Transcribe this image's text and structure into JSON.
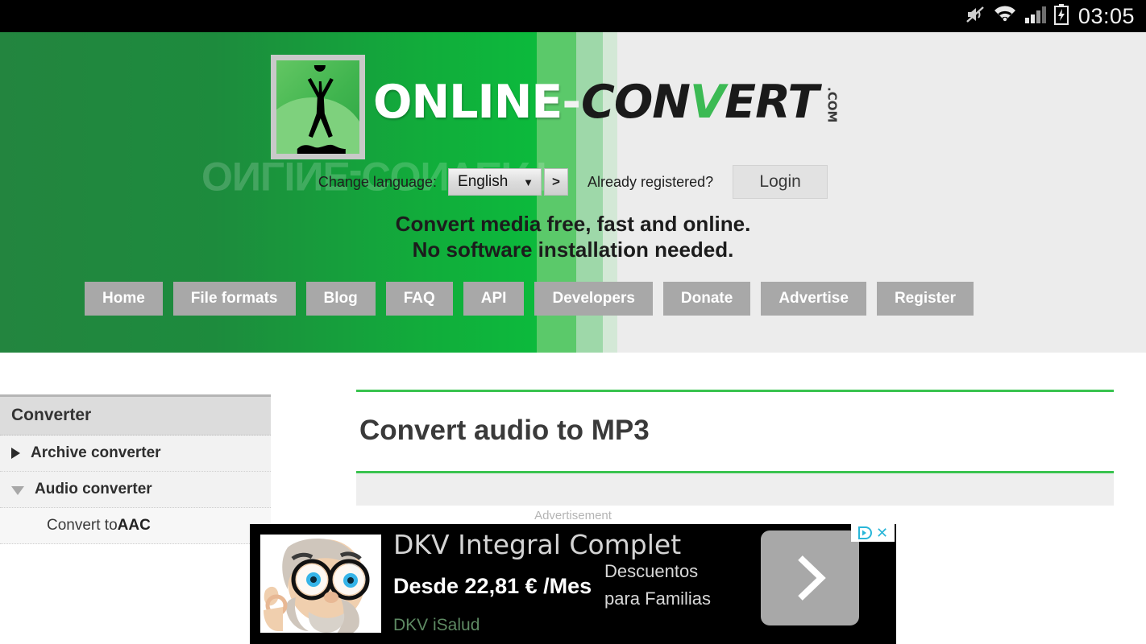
{
  "statusbar": {
    "time": "03:05",
    "icons": [
      "mute-icon",
      "wifi-icon",
      "signal-icon",
      "battery-charging-icon"
    ]
  },
  "header": {
    "logo": {
      "online": "ONLINE",
      "dash": "-",
      "convert_pre": "CON",
      "convert_v": "V",
      "convert_post": "ERT",
      "com": ".COM",
      "reflection": "ONLINE-CONVERT"
    },
    "language": {
      "label": "Change language:",
      "selected": "English",
      "caret": "▼",
      "go_label": ">"
    },
    "account": {
      "already_registered": "Already registered?",
      "login_label": "Login"
    },
    "tagline_line1": "Convert media free, fast and online.",
    "tagline_line2": "No software installation needed.",
    "nav": [
      {
        "label": "Home"
      },
      {
        "label": "File formats"
      },
      {
        "label": "Blog"
      },
      {
        "label": "FAQ"
      },
      {
        "label": "API"
      },
      {
        "label": "Developers"
      },
      {
        "label": "Donate"
      },
      {
        "label": "Advertise"
      },
      {
        "label": "Register"
      }
    ],
    "colors": {
      "green_dark": "#23853f",
      "green_bright": "#0cba3c",
      "green_light": "#5bc96a",
      "green_pale": "#9ed8a9",
      "gray_bg": "#ececec",
      "nav_button": "#a8a8a8"
    }
  },
  "sidebar": {
    "title": "Converter",
    "items": [
      {
        "label": "Archive converter",
        "state": "collapsed",
        "arrow": "triangle-right-icon"
      },
      {
        "label": "Audio converter",
        "state": "expanded",
        "arrow": "triangle-down-icon"
      }
    ],
    "subitems": [
      {
        "prefix": "Convert to ",
        "format": "AAC"
      }
    ]
  },
  "main": {
    "title": "Convert audio to MP3",
    "rule_color": "#39c34f"
  },
  "advertisement": {
    "label": "Advertisement",
    "headline": "DKV Integral Complet",
    "price": "Desde 22,81 € /Mes",
    "desc_line1": "Descuentos",
    "desc_line2": "para Familias",
    "brand": "DKV iSalud",
    "cta": "›",
    "close_label": "✕",
    "adchoices": "adchoices-icon",
    "image_alt": "cartoon-man-with-glasses"
  }
}
